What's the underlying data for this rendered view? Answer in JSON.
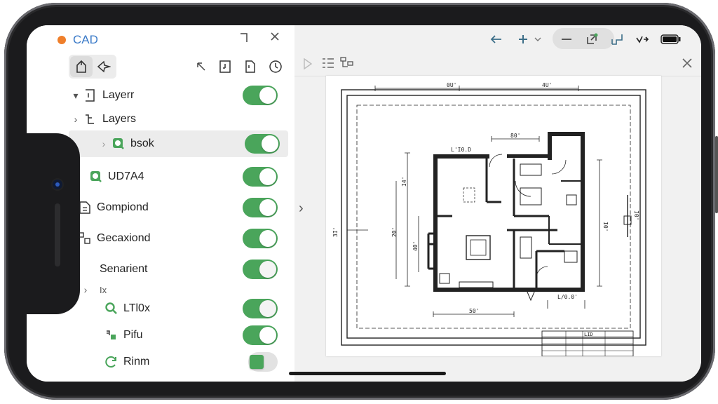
{
  "app": {
    "title": "CAD"
  },
  "layers": [
    {
      "label": "Layerr",
      "toggle": "on"
    },
    {
      "label": "Layers",
      "toggle": "none"
    },
    {
      "label": "bsok",
      "toggle": "on",
      "selected": true
    },
    {
      "label": "UD7A4",
      "toggle": "on"
    },
    {
      "label": "Gompiond",
      "toggle": "on"
    },
    {
      "label": "Gecaxiond",
      "toggle": "on"
    },
    {
      "label": "Senarient",
      "toggle": "off"
    },
    {
      "label": "Ix",
      "toggle": "none"
    },
    {
      "label": "LTl0x",
      "toggle": "off"
    },
    {
      "label": "Pifu",
      "toggle": "on"
    },
    {
      "label": "Rinm",
      "toggle": "partial"
    }
  ],
  "drawing": {
    "dims": {
      "top_left": "0U'",
      "top_right": "4U'",
      "kitchen": "80'",
      "room_label": "L'I0.D",
      "left_side": "I4'",
      "left_mid": "20'",
      "left_low": "40'",
      "left_outer": "3I'",
      "right_side": "I0'",
      "right_outer": "I0'",
      "bottom": "50'",
      "bottom_right": "L/0.0'"
    },
    "title_block": {
      "label": "LID"
    }
  },
  "icons": {
    "toolbar_left": [
      "home-icon",
      "pin-icon"
    ],
    "toolbar_right": [
      "pointer-icon",
      "layer-add-icon",
      "document-icon",
      "clock-icon"
    ],
    "topbar": [
      "back-arrow-icon",
      "plus-icon",
      "chevron-down-icon",
      "minus-icon",
      "export-icon",
      "resize-icon",
      "share-icon",
      "battery-icon"
    ],
    "subbar": [
      "play-icon",
      "list-icon",
      "tree-icon",
      "close-icon"
    ]
  },
  "colors": {
    "accent": "#3a7ac8",
    "toggle_on": "#4aa55b",
    "dot": "#ef7f2b"
  }
}
